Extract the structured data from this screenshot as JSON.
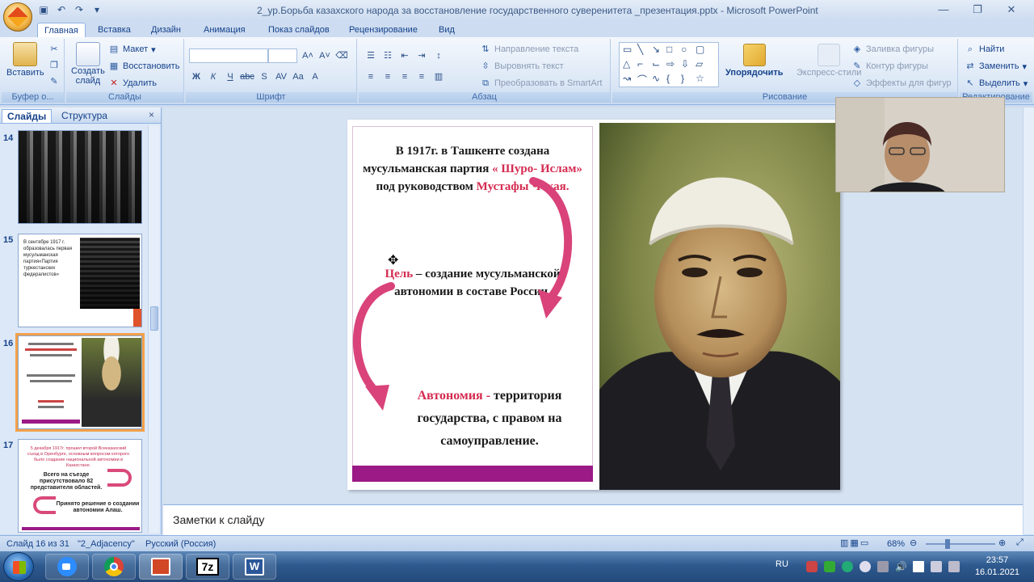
{
  "window": {
    "title": "2_ур.Борьба казахского народа за восстановление государственного  суверенитета _презентация.pptx - Microsoft PowerPoint"
  },
  "ribbon": {
    "tabs": [
      "Главная",
      "Вставка",
      "Дизайн",
      "Анимация",
      "Показ слайдов",
      "Рецензирование",
      "Вид"
    ],
    "active_tab": "Главная",
    "clipboard": {
      "paste": "Вставить",
      "label": "Буфер о..."
    },
    "slides": {
      "new_slide_1": "Создать",
      "new_slide_2": "слайд",
      "layout": "Макет",
      "reset": "Восстановить",
      "delete": "Удалить",
      "label": "Слайды"
    },
    "font": {
      "label": "Шрифт"
    },
    "paragraph": {
      "text_direction": "Направление текста",
      "align_text": "Выровнять текст",
      "smartart": "Преобразовать в SmartArt",
      "label": "Абзац"
    },
    "drawing": {
      "arrange": "Упорядочить",
      "quick_styles": "Экспресс-стили",
      "shape_fill": "Заливка фигуры",
      "shape_outline": "Контур фигуры",
      "shape_effects": "Эффекты для фигур",
      "label": "Рисование"
    },
    "editing": {
      "find": "Найти",
      "replace": "Заменить",
      "select": "Выделить",
      "label": "Редактирование"
    }
  },
  "left_pane": {
    "tabs": [
      "Слайды",
      "Структура"
    ],
    "active_tab": "Слайды",
    "close": "×",
    "thumbnails": [
      {
        "number": "14"
      },
      {
        "number": "15",
        "text": "В сентябре 1917 г. образовалась первая мусульманская партия«Партия туркестанских федералистов»"
      },
      {
        "number": "16",
        "selected": true
      },
      {
        "number": "17",
        "text1": "5 декабря 1917г. прошел второй Всеказахский съезд в Оренбурге, основным вопросом которого было создание национальной автономии в Казахстане.",
        "text2": "Всего на съезде присутствовало 82 представителя областей.",
        "text3": "Принято решение о создании автономии Алаш."
      }
    ]
  },
  "slide": {
    "line1": "В 1917г. в Ташкенте создана",
    "line2a": "мусульманская партия ",
    "line2b": "« Шуро- Ислам»",
    "line3a": "под руководством ",
    "line3b": "Мустафы Чокая.",
    "goal_word": "Цель",
    "goal_rest": " – создание мусульманской",
    "goal_line2": "автономии в составе России.",
    "autonomy_word": "Автономия - ",
    "autonomy_rest": "территория",
    "autonomy_line2": "государства, с правом на",
    "autonomy_line3": "самоуправление."
  },
  "notes": {
    "placeholder": "Заметки к слайду"
  },
  "status": {
    "slide_pos": "Слайд 16 из 31",
    "theme": "\"2_Adjacency\"",
    "language": "Русский (Россия)",
    "zoom": "68%"
  },
  "taskbar": {
    "lang": "RU",
    "time": "23:57",
    "date": "16.01.2021"
  },
  "colors": {
    "accent_red": "#d42a4f",
    "accent_purple": "#9b1a86",
    "ribbon_text": "#15428b"
  }
}
